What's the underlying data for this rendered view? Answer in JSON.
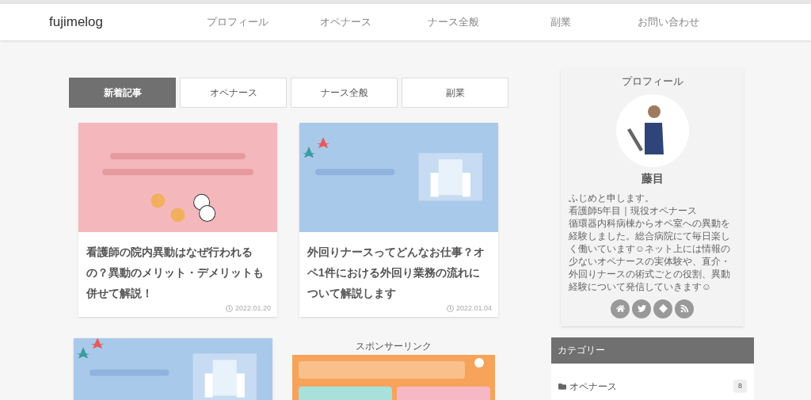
{
  "header": {
    "logo": "fujimelog",
    "nav": [
      "プロフィール",
      "オペナース",
      "ナース全般",
      "副業",
      "お問い合わせ"
    ]
  },
  "tabs": [
    {
      "label": "新着記事",
      "selected": true
    },
    {
      "label": "オペナース",
      "selected": false
    },
    {
      "label": "ナース全般",
      "selected": false
    },
    {
      "label": "副業",
      "selected": false
    }
  ],
  "articles": [
    {
      "thumb": {
        "kind": "picture"
      },
      "title": "看護師の院内異動はなぜ行われるの？異動のメリット・デメリットも併せて解説！",
      "date": "2022.01.20"
    },
    {
      "thumb": {
        "kind": "picture"
      },
      "title": "外回りナースってどんなお仕事？オペ1件における外回り業務の流れについて解説します",
      "date": "2022.01.04"
    },
    {
      "thumb": {
        "kind": "picture"
      }
    }
  ],
  "sponsor": {
    "label": "スポンサーリンク"
  },
  "profile": {
    "heading": "プロフィール",
    "name": "藤目",
    "bio": [
      "ふじめと申します。",
      "看護師5年目｜現役オペナース",
      "循環器内科病棟からオペ室への異動を経験しました。総合病院にて毎日楽しく働いています☺ネット上には情報の少ないオペナースの実体験や、直介・外回りナースの術式ごとの役割、異動経験について発信していきます☺"
    ]
  },
  "categories": {
    "heading": "カテゴリー",
    "items": [
      {
        "label": "オペナース",
        "count": "8"
      }
    ]
  }
}
